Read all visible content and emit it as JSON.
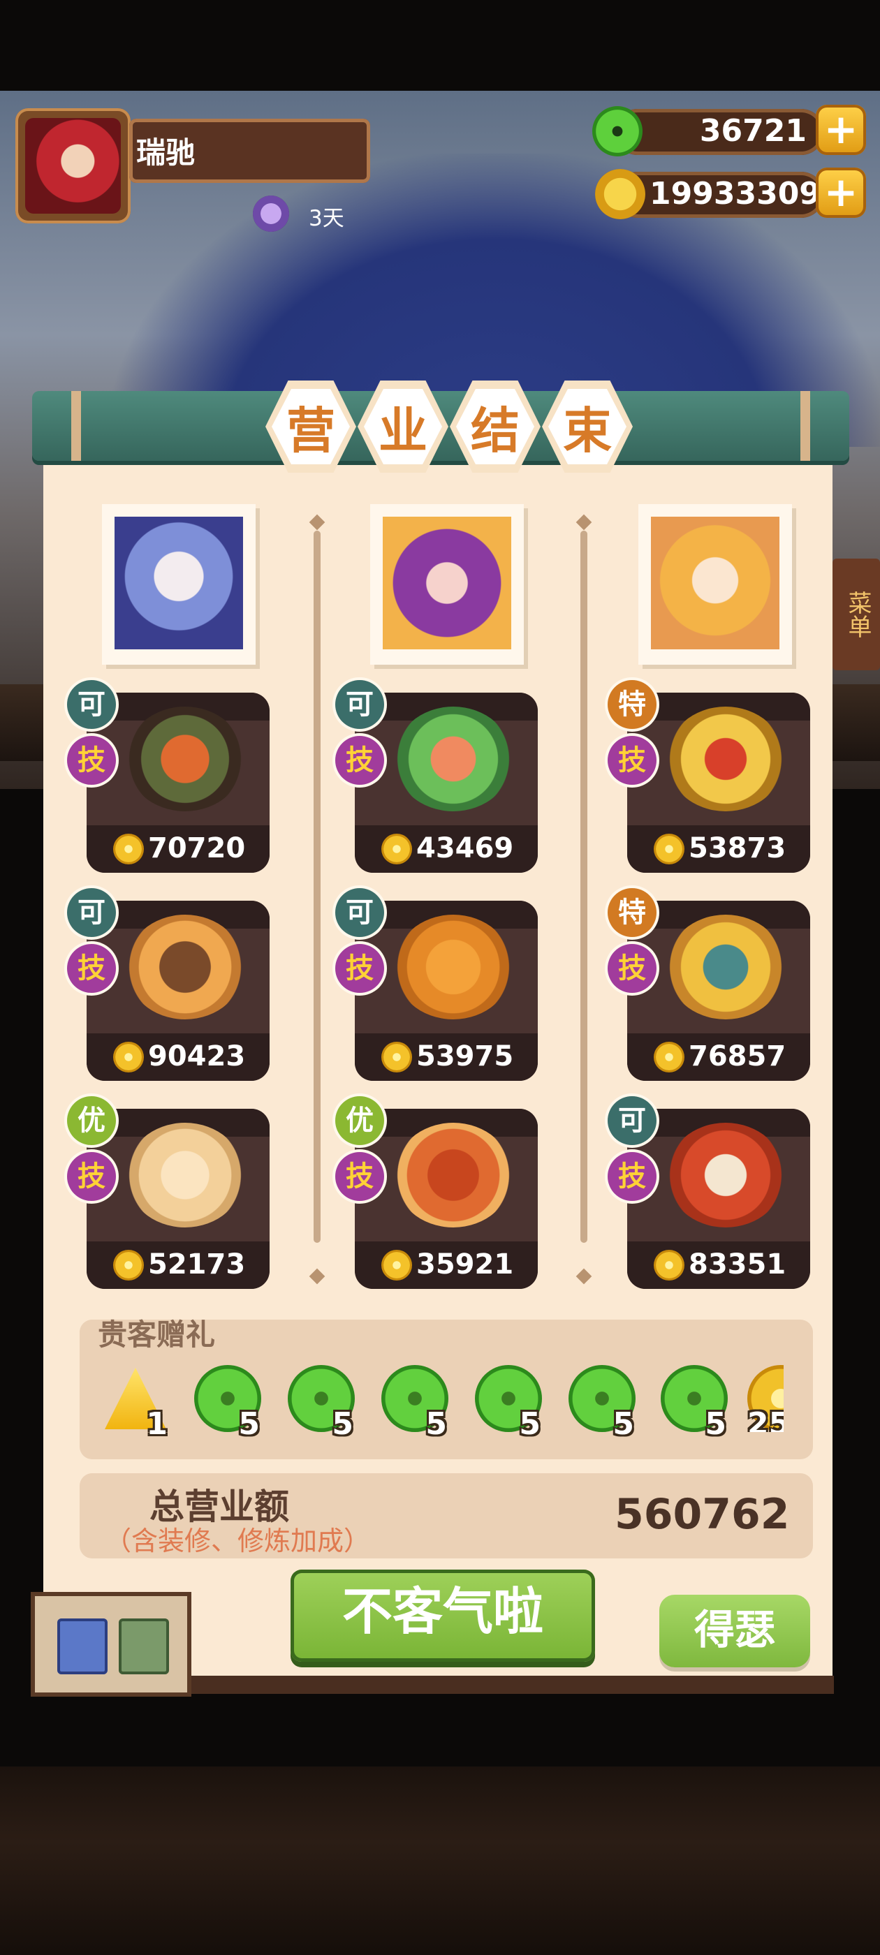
{
  "player": {
    "name": "瑞驰",
    "days": "3天"
  },
  "currency": {
    "jade": "36721",
    "coins": "19933309",
    "plus_glyph": "+"
  },
  "title_chars": [
    "营",
    "业",
    "结",
    "束"
  ],
  "side_menu": "菜单",
  "chefs": [
    {
      "dishes": [
        {
          "grade": "可",
          "skill": "技",
          "value": "70720",
          "grade_color": "#3b6e6a"
        },
        {
          "grade": "可",
          "skill": "技",
          "value": "90423",
          "grade_color": "#3b6e6a"
        },
        {
          "grade": "优",
          "skill": "技",
          "value": "52173",
          "grade_color": "#8bb832"
        }
      ]
    },
    {
      "dishes": [
        {
          "grade": "可",
          "skill": "技",
          "value": "43469",
          "grade_color": "#3b6e6a"
        },
        {
          "grade": "可",
          "skill": "技",
          "value": "53975",
          "grade_color": "#3b6e6a"
        },
        {
          "grade": "优",
          "skill": "技",
          "value": "35921",
          "grade_color": "#8bb832"
        }
      ]
    },
    {
      "dishes": [
        {
          "grade": "特",
          "skill": "技",
          "value": "53873",
          "grade_color": "#d27a22"
        },
        {
          "grade": "特",
          "skill": "技",
          "value": "76857",
          "grade_color": "#d27a22"
        },
        {
          "grade": "可",
          "skill": "技",
          "value": "83351",
          "grade_color": "#3b6e6a"
        }
      ]
    }
  ],
  "gift": {
    "title": "贵客赠礼",
    "items": [
      {
        "icon": "token-icon",
        "amount": "1"
      },
      {
        "icon": "jade-icon",
        "amount": "5"
      },
      {
        "icon": "jade-icon",
        "amount": "5"
      },
      {
        "icon": "jade-icon",
        "amount": "5"
      },
      {
        "icon": "jade-icon",
        "amount": "5"
      },
      {
        "icon": "jade-icon",
        "amount": "5"
      },
      {
        "icon": "jade-icon",
        "amount": "5"
      },
      {
        "icon": "coin-icon",
        "amount": "25"
      }
    ]
  },
  "total": {
    "label": "总营业额",
    "note": "（含装修、修炼加成）",
    "value": "560762"
  },
  "buttons": {
    "polite": "不客气啦",
    "gain": "得瑟"
  },
  "colors": {
    "panel_bg": "#fbe9d3",
    "banner": "#4f8a7d",
    "title_text": "#d77a28",
    "button_green": "#8bc34a"
  }
}
